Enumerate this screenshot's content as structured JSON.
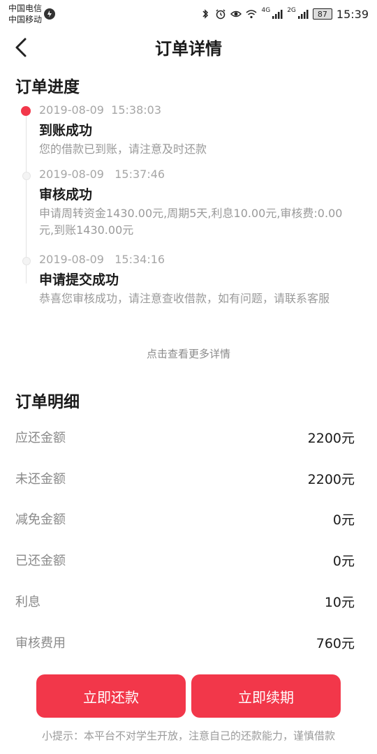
{
  "status_bar": {
    "carrier_1": "中国电信",
    "carrier_2": "中国移动",
    "net_4g": "4G",
    "net_2g": "2G",
    "battery": "87",
    "time": "15:39"
  },
  "header": {
    "title": "订单详情"
  },
  "progress": {
    "title": "订单进度",
    "items": [
      {
        "time": "2019-08-09  15:38:03",
        "title": "到账成功",
        "desc": "您的借款已到账，请注意及时还款",
        "active": true
      },
      {
        "time": "2019-08-09   15:37:46",
        "title": "审核成功",
        "desc": "申请周转资金1430.00元,周期5天,利息10.00元,审核费:0.00元,到账1430.00元",
        "active": false
      },
      {
        "time": "2019-08-09   15:34:16",
        "title": "申请提交成功",
        "desc": "恭喜您审核成功，请注意查收借款，如有问题，请联系客服",
        "active": false
      }
    ],
    "more_link": "点击查看更多详情"
  },
  "detail": {
    "title": "订单明细",
    "rows": [
      {
        "label": "应还金额",
        "value": "2200元"
      },
      {
        "label": "未还金额",
        "value": "2200元"
      },
      {
        "label": "减免金额",
        "value": "0元"
      },
      {
        "label": "已还金额",
        "value": "0元"
      },
      {
        "label": "利息",
        "value": "10元"
      },
      {
        "label": "审核费用",
        "value": "760元"
      }
    ]
  },
  "actions": {
    "repay_label": "立即还款",
    "renew_label": "立即续期"
  },
  "tip": "小提示：本平台不对学生开放，注意自己的还款能力，谨慎借款",
  "colors": {
    "accent": "#f2374a",
    "text_primary": "#1a1a1a",
    "text_secondary": "#9a9a9a"
  }
}
